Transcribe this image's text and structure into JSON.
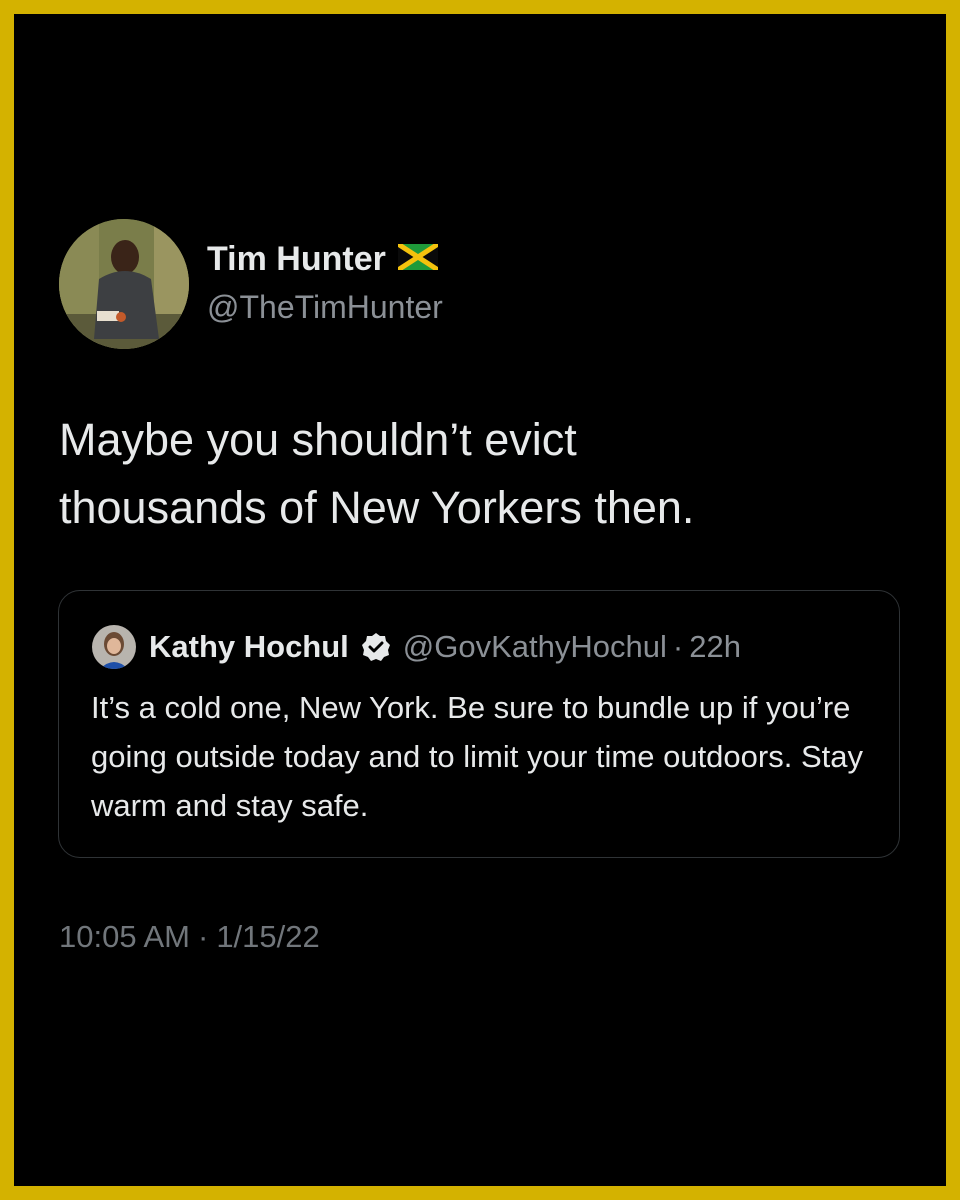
{
  "tweet": {
    "author_name": "Tim Hunter",
    "author_handle": "@TheTimHunter",
    "flag_icon": "jamaica-flag-icon",
    "text": "Maybe you shouldn’t evict\nthousands of New Yorkers then.",
    "time": "10:05 AM",
    "sep": "·",
    "date": "1/15/22"
  },
  "quote": {
    "author_name": "Kathy Hochul",
    "verified_icon": "verified-badge-icon",
    "author_handle": "@GovKathyHochul",
    "sep": "·",
    "age": "22h",
    "text": "It’s a cold one, New York. Be sure to bundle up if you’re going outside today and to limit your time outdoors. Stay warm and stay safe."
  },
  "colors": {
    "frame": "#d4b200",
    "background": "#000000",
    "text": "#e7e9ea",
    "muted": "#8b9096"
  }
}
